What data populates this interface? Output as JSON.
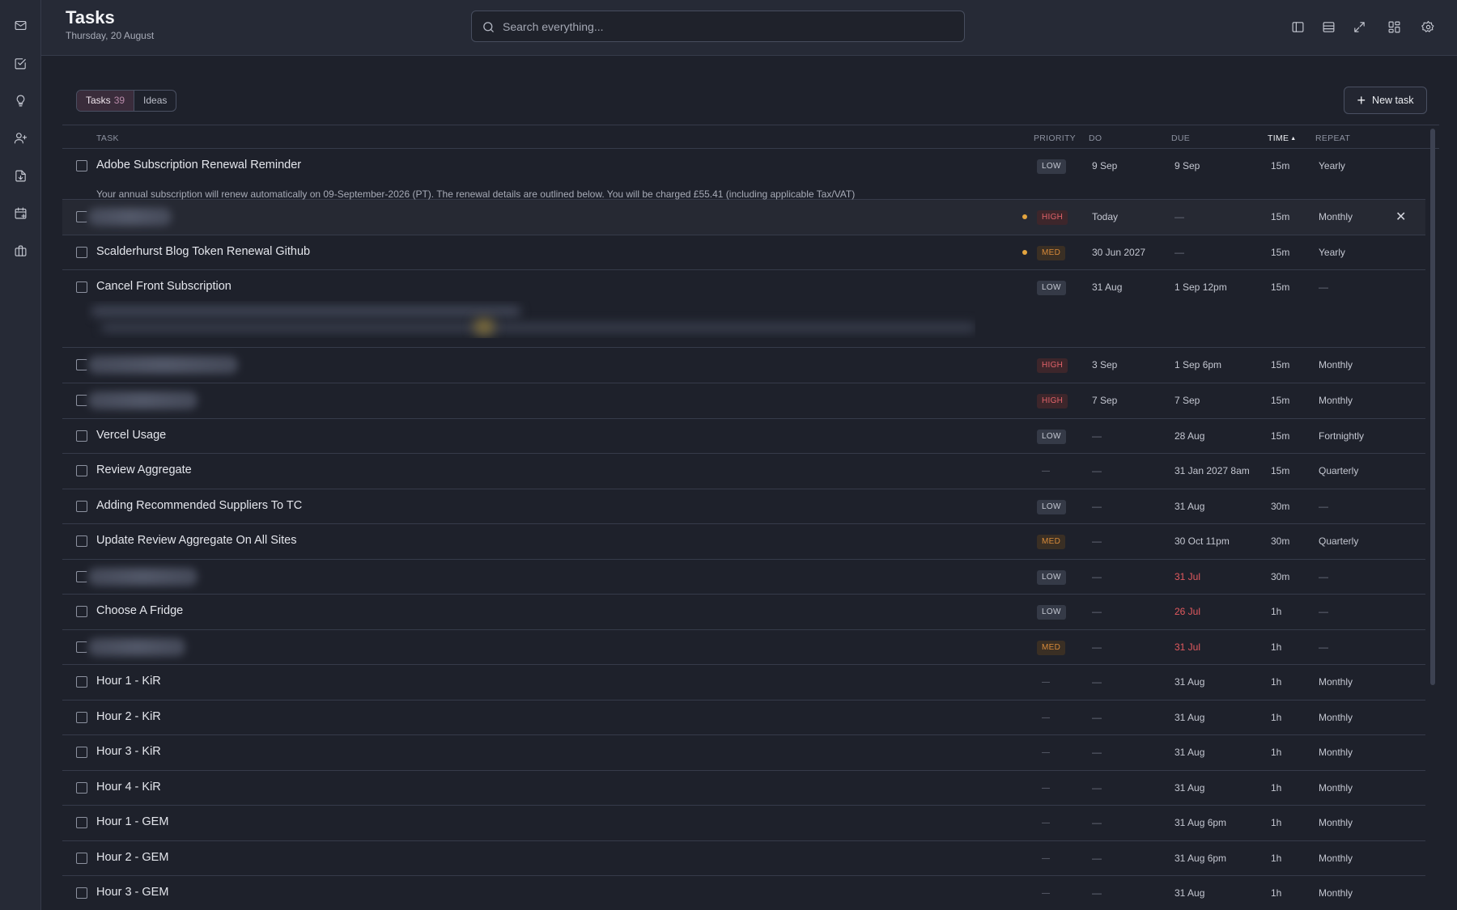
{
  "header": {
    "title": "Tasks",
    "date": "Thursday, 20 August",
    "search_placeholder": "Search everything..."
  },
  "nav_icons": [
    "mail-icon",
    "checkbox-icon",
    "lightbulb-icon",
    "user-plus-icon",
    "file-download-icon",
    "calendar-icon",
    "briefcase-icon"
  ],
  "header_icons": [
    "sidebar-panel-icon",
    "table-layout-icon",
    "expand-icon",
    "dashboard-grid-icon",
    "settings-icon"
  ],
  "toolbar": {
    "tabs": [
      {
        "label": "Tasks",
        "count": "39",
        "active": true
      },
      {
        "label": "Ideas",
        "count": "",
        "active": false
      }
    ],
    "new_task_label": "New task"
  },
  "columns": {
    "task": "TASK",
    "priority": "PRIORITY",
    "do": "DO",
    "due": "DUE",
    "time": "TIME",
    "repeat": "REPEAT"
  },
  "colors": {
    "priority_high": "#e2626a",
    "priority_med": "#d88a3a",
    "overdue": "#e25a5f",
    "flag_dot": "#e3a43f"
  },
  "rows": [
    {
      "title": "Adobe Subscription Renewal Reminder",
      "description": "Your annual subscription will renew automatically on 09-September-2026 (PT). The renewal details are outlined below. You will be charged £55.41 (including applicable Tax/VAT)",
      "priority": "LOW",
      "do": "9 Sep",
      "due": "9 Sep",
      "time": "15m",
      "repeat": "Yearly"
    },
    {
      "title": "",
      "blurred": true,
      "flag": true,
      "priority": "HIGH",
      "do": "Today",
      "due": "—",
      "time": "15m",
      "repeat": "Monthly",
      "highlighted": true
    },
    {
      "title": "Scalderhurst Blog Token Renewal Github",
      "flag": true,
      "priority": "MED",
      "do": "30 Jun 2027",
      "due": "—",
      "time": "15m",
      "repeat": "Yearly"
    },
    {
      "title": "Cancel Front Subscription",
      "blurred_desc": true,
      "priority": "LOW",
      "do": "31 Aug",
      "due": "1 Sep 12pm",
      "time": "15m",
      "repeat": "—"
    },
    {
      "title": "",
      "blurred": true,
      "priority": "HIGH",
      "do": "3 Sep",
      "due": "1 Sep 6pm",
      "time": "15m",
      "repeat": "Monthly"
    },
    {
      "title": "",
      "blurred": true,
      "priority": "HIGH",
      "do": "7 Sep",
      "due": "7 Sep",
      "time": "15m",
      "repeat": "Monthly"
    },
    {
      "title": "Vercel Usage",
      "priority": "LOW",
      "do": "—",
      "due": "28 Aug",
      "time": "15m",
      "repeat": "Fortnightly"
    },
    {
      "title": "Review Aggregate",
      "priority": "—",
      "do": "—",
      "due": "31 Jan 2027 8am",
      "time": "15m",
      "repeat": "Quarterly"
    },
    {
      "title": "Adding Recommended Suppliers To TC",
      "priority": "LOW",
      "do": "—",
      "due": "31 Aug",
      "time": "30m",
      "repeat": "—"
    },
    {
      "title": "Update Review Aggregate On All Sites",
      "priority": "MED",
      "do": "—",
      "due": "30 Oct 11pm",
      "time": "30m",
      "repeat": "Quarterly"
    },
    {
      "title": "",
      "blurred": true,
      "priority": "LOW",
      "do": "—",
      "due": "31 Jul",
      "overdue": true,
      "time": "30m",
      "repeat": "—"
    },
    {
      "title": "Choose A Fridge",
      "priority": "LOW",
      "do": "—",
      "due": "26 Jul",
      "overdue": true,
      "time": "1h",
      "repeat": "—"
    },
    {
      "title": "",
      "blurred": true,
      "priority": "MED",
      "do": "—",
      "due": "31 Jul",
      "overdue": true,
      "time": "1h",
      "repeat": "—"
    },
    {
      "title": "Hour 1 - KiR",
      "priority": "—",
      "do": "—",
      "due": "31 Aug",
      "time": "1h",
      "repeat": "Monthly"
    },
    {
      "title": "Hour 2 - KiR",
      "priority": "—",
      "do": "—",
      "due": "31 Aug",
      "time": "1h",
      "repeat": "Monthly"
    },
    {
      "title": "Hour 3 - KiR",
      "priority": "—",
      "do": "—",
      "due": "31 Aug",
      "time": "1h",
      "repeat": "Monthly"
    },
    {
      "title": "Hour 4 - KiR",
      "priority": "—",
      "do": "—",
      "due": "31 Aug",
      "time": "1h",
      "repeat": "Monthly"
    },
    {
      "title": "Hour 1 - GEM",
      "priority": "—",
      "do": "—",
      "due": "31 Aug 6pm",
      "time": "1h",
      "repeat": "Monthly"
    },
    {
      "title": "Hour 2 - GEM",
      "priority": "—",
      "do": "—",
      "due": "31 Aug 6pm",
      "time": "1h",
      "repeat": "Monthly"
    },
    {
      "title": "Hour 3 - GEM",
      "priority": "—",
      "do": "—",
      "due": "31 Aug",
      "time": "1h",
      "repeat": "Monthly"
    }
  ]
}
